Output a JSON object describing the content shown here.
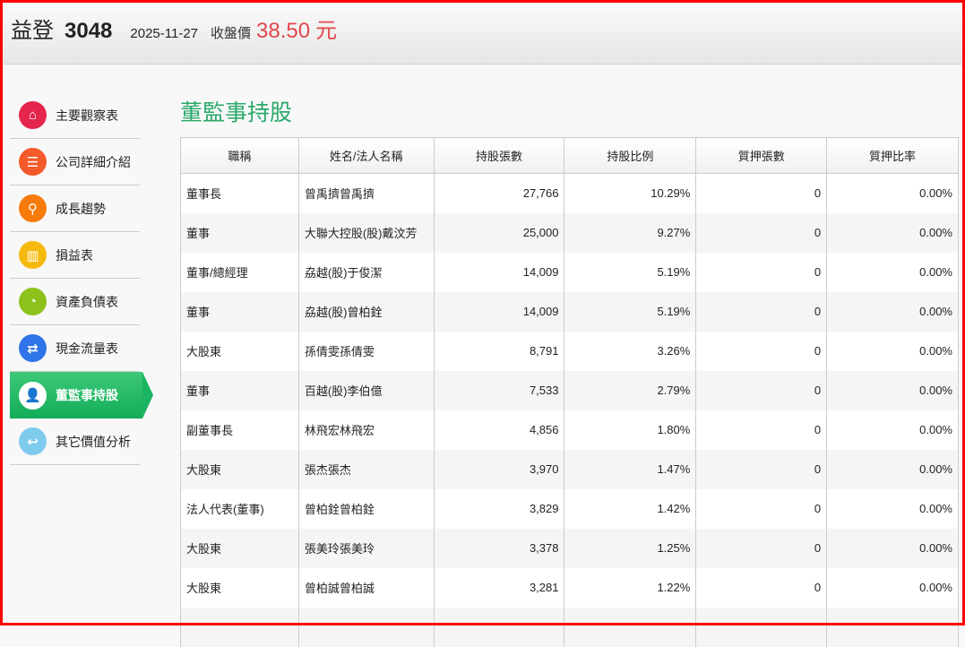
{
  "header": {
    "name": "益登",
    "code": "3048",
    "date": "2025-11-27",
    "price_label": "收盤價",
    "price": "38.50",
    "unit": "元"
  },
  "sidebar": {
    "items": [
      {
        "label": "主要觀察表",
        "icon": "home-icon",
        "color": "#e4264d",
        "glyph": "⌂"
      },
      {
        "label": "公司詳細介紹",
        "icon": "list-icon",
        "color": "#f45a2a",
        "glyph": "☰"
      },
      {
        "label": "成長趨勢",
        "icon": "search-icon",
        "color": "#f77b0b",
        "glyph": "⚲"
      },
      {
        "label": "損益表",
        "icon": "bar-chart-icon",
        "color": "#f6b90e",
        "glyph": "▥"
      },
      {
        "label": "資產負債表",
        "icon": "pie-chart-icon",
        "color": "#8cc21b",
        "glyph": "◔"
      },
      {
        "label": "現金流量表",
        "icon": "exchange-icon",
        "color": "#2f74e8",
        "glyph": "⇄"
      },
      {
        "label": "董監事持股",
        "icon": "user-icon",
        "color": "#ffffff",
        "glyph": "👤",
        "active": true
      },
      {
        "label": "其它價值分析",
        "icon": "reply-icon",
        "color": "#7ecbed",
        "glyph": "↩"
      }
    ]
  },
  "main": {
    "title": "董監事持股",
    "columns": [
      "職稱",
      "姓名/法人名稱",
      "持股張數",
      "持股比例",
      "質押張數",
      "質押比率"
    ],
    "rows": [
      [
        "董事長",
        "曾禹擠曾禹擠",
        "27,766",
        "10.29%",
        "0",
        "0.00%"
      ],
      [
        "董事",
        "大聯大控股(股)戴汶芳",
        "25,000",
        "9.27%",
        "0",
        "0.00%"
      ],
      [
        "董事/總經理",
        "劦越(股)于俊潔",
        "14,009",
        "5.19%",
        "0",
        "0.00%"
      ],
      [
        "董事",
        "劦越(股)曾柏銓",
        "14,009",
        "5.19%",
        "0",
        "0.00%"
      ],
      [
        "大股東",
        "孫倩雯孫倩雯",
        "8,791",
        "3.26%",
        "0",
        "0.00%"
      ],
      [
        "董事",
        "百越(股)李伯億",
        "7,533",
        "2.79%",
        "0",
        "0.00%"
      ],
      [
        "副董事長",
        "林飛宏林飛宏",
        "4,856",
        "1.80%",
        "0",
        "0.00%"
      ],
      [
        "大股東",
        "張杰張杰",
        "3,970",
        "1.47%",
        "0",
        "0.00%"
      ],
      [
        "法人代表(董事)",
        "曾柏銓曾柏銓",
        "3,829",
        "1.42%",
        "0",
        "0.00%"
      ],
      [
        "大股東",
        "張美玲張美玲",
        "3,378",
        "1.25%",
        "0",
        "0.00%"
      ],
      [
        "大股東",
        "曾柏誠曾柏誠",
        "3,281",
        "1.22%",
        "0",
        "0.00%"
      ]
    ]
  }
}
